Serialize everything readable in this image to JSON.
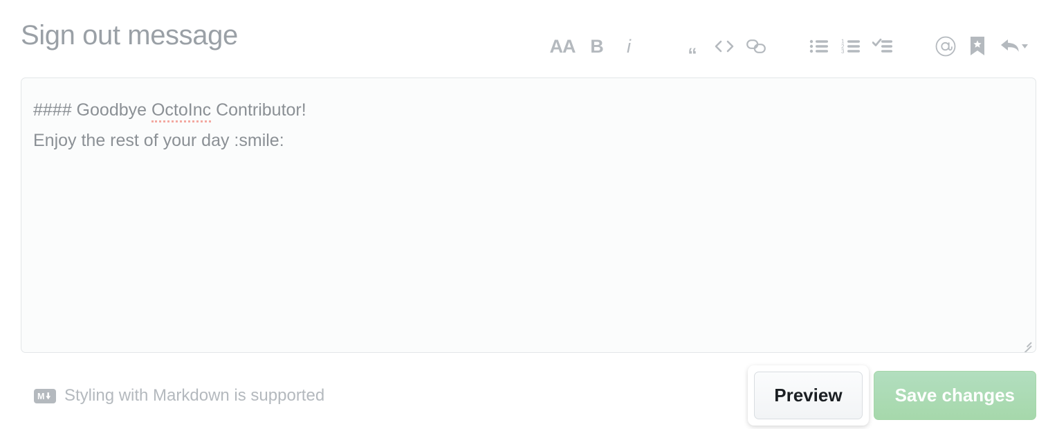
{
  "header": {
    "title": "Sign out message"
  },
  "toolbar": {
    "items": [
      {
        "name": "heading-icon",
        "label": "Add heading text",
        "glyph": "AA"
      },
      {
        "name": "bold-icon",
        "label": "Add bold text",
        "glyph": "B"
      },
      {
        "name": "italic-icon",
        "label": "Add italic text",
        "glyph": "i"
      },
      {
        "name": "quote-icon",
        "label": "Add a quote",
        "glyph": "“"
      },
      {
        "name": "code-icon",
        "label": "Add code",
        "glyph": "<>"
      },
      {
        "name": "link-icon",
        "label": "Add a link",
        "glyph": "link"
      },
      {
        "name": "unordered-list-icon",
        "label": "Add a bulleted list",
        "glyph": "list"
      },
      {
        "name": "ordered-list-icon",
        "label": "Add a numbered list",
        "glyph": "123"
      },
      {
        "name": "task-list-icon",
        "label": "Add a task list",
        "glyph": "check"
      },
      {
        "name": "mention-icon",
        "label": "Directly mention a user or team",
        "glyph": "@"
      },
      {
        "name": "saved-reply-icon",
        "label": "Reference a saved reply",
        "glyph": "bookmark"
      },
      {
        "name": "reply-icon",
        "label": "Reply",
        "glyph": "reply"
      }
    ],
    "ordered_list_numbers": [
      "1",
      "2",
      "3"
    ]
  },
  "editor": {
    "line1_prefix": "#### Goodbye ",
    "line1_misspelled": "OctoInc",
    "line1_suffix": " Contributor!",
    "line2": "Enjoy the rest of your day :smile:",
    "resize_handle": "resize-handle"
  },
  "footer": {
    "markdown_badge": "M",
    "markdown_hint": "Styling with Markdown is supported",
    "preview_label": "Preview",
    "save_label": "Save changes"
  },
  "colors": {
    "title_text": "#9aa0a6",
    "toolbar_icon": "#b4b9be",
    "editor_text": "#8b9095",
    "spellcheck_underline": "#f3a8a0",
    "save_button_bg": "#acdcae",
    "editor_border": "#e3e6e8",
    "editor_bg": "#fbfcfc",
    "preview_text": "#1b1f23"
  }
}
